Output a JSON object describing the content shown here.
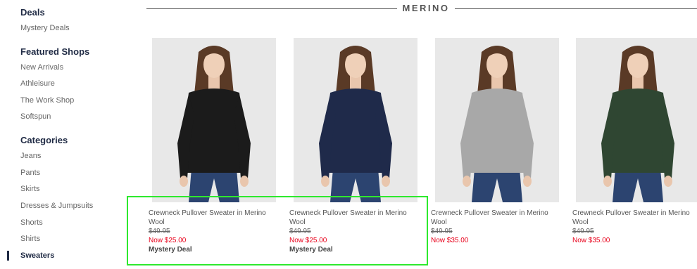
{
  "sidebar": {
    "deals_heading": "Deals",
    "deals_items": [
      "Mystery Deals"
    ],
    "featured_heading": "Featured Shops",
    "featured_items": [
      "New Arrivals",
      "Athleisure",
      "The Work Shop",
      "Softspun"
    ],
    "categories_heading": "Categories",
    "categories_items": [
      "Jeans",
      "Pants",
      "Skirts",
      "Dresses & Jumpsuits",
      "Shorts",
      "Shirts",
      "Sweaters"
    ],
    "active_item": "Sweaters"
  },
  "section": {
    "title": "MERINO"
  },
  "products": [
    {
      "name": "Crewneck Pullover Sweater in Merino Wool",
      "original_price": "$49.95",
      "sale_price": "Now $25.00",
      "badge": "Mystery Deal",
      "sweater_color": "#1b1b1b"
    },
    {
      "name": "Crewneck Pullover Sweater in Merino Wool",
      "original_price": "$49.95",
      "sale_price": "Now $25.00",
      "badge": "Mystery Deal",
      "sweater_color": "#1f2a4a"
    },
    {
      "name": "Crewneck Pullover Sweater in Merino Wool",
      "original_price": "$49.95",
      "sale_price": "Now $35.00",
      "badge": "",
      "sweater_color": "#a8a8a8"
    },
    {
      "name": "Crewneck Pullover Sweater in Merino Wool",
      "original_price": "$49.95",
      "sale_price": "Now $35.00",
      "badge": "",
      "sweater_color": "#2f4632"
    }
  ],
  "colors": {
    "accent_navy": "#1f2a44",
    "sale_red": "#e8001a",
    "highlight_green": "#2ee92e"
  }
}
